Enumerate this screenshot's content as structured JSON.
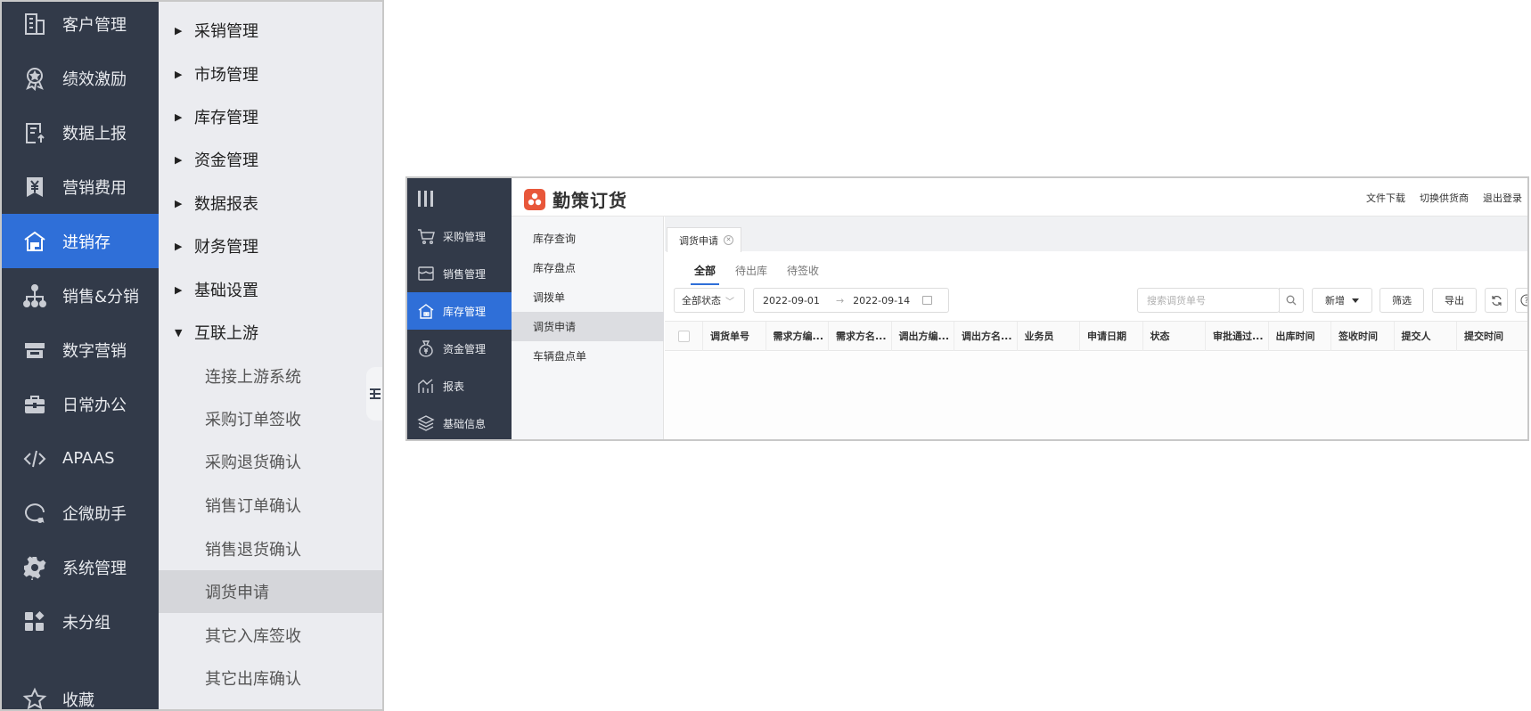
{
  "left_panel": {
    "nav_items": [
      {
        "label": "客户管理",
        "icon": "building-icon",
        "active": false
      },
      {
        "label": "绩效激励",
        "icon": "medal-icon",
        "active": false
      },
      {
        "label": "数据上报",
        "icon": "report-upload-icon",
        "active": false
      },
      {
        "label": "营销费用",
        "icon": "yen-bookmark-icon",
        "active": false
      },
      {
        "label": "进销存",
        "icon": "warehouse-icon",
        "active": true
      },
      {
        "label": "销售&分销",
        "icon": "org-tree-icon",
        "active": false
      },
      {
        "label": "数字营销",
        "icon": "store-icon",
        "active": false
      },
      {
        "label": "日常办公",
        "icon": "briefcase-icon",
        "active": false
      },
      {
        "label": "APAAS",
        "icon": "code-icon",
        "active": false
      },
      {
        "label": "企微助手",
        "icon": "chat-user-icon",
        "active": false
      },
      {
        "label": "系统管理",
        "icon": "gear-icon",
        "active": false
      },
      {
        "label": "未分组",
        "icon": "grid-apps-icon",
        "active": false
      },
      {
        "label": "收藏",
        "icon": "star-icon",
        "active": false
      }
    ],
    "submenu": [
      {
        "label": "采销管理"
      },
      {
        "label": "市场管理"
      },
      {
        "label": "库存管理"
      },
      {
        "label": "资金管理"
      },
      {
        "label": "数据报表"
      },
      {
        "label": "财务管理"
      },
      {
        "label": "基础设置"
      },
      {
        "label": "互联上游"
      }
    ],
    "submenu_children": [
      {
        "label": "连接上游系统",
        "active": false
      },
      {
        "label": "采购订单签收",
        "active": false
      },
      {
        "label": "采购退货确认",
        "active": false
      },
      {
        "label": "销售订单确认",
        "active": false
      },
      {
        "label": "销售退货确认",
        "active": false
      },
      {
        "label": "调货申请",
        "active": true
      },
      {
        "label": "其它入库签收",
        "active": false
      },
      {
        "label": "其它出库确认",
        "active": false
      }
    ]
  },
  "app": {
    "brand": {
      "name": "勤策订货",
      "color": "#e8573a"
    },
    "header_links": [
      "文件下载",
      "切换供货商",
      "退出登录"
    ],
    "nav_items": [
      {
        "label": "采购管理",
        "icon": "cart-icon",
        "active": false
      },
      {
        "label": "销售管理",
        "icon": "storefront-icon",
        "active": false
      },
      {
        "label": "库存管理",
        "icon": "warehouse-icon",
        "active": true
      },
      {
        "label": "资金管理",
        "icon": "money-bag-icon",
        "active": false
      },
      {
        "label": "报表",
        "icon": "chart-icon",
        "active": false
      },
      {
        "label": "基础信息",
        "icon": "layers-icon",
        "active": false
      }
    ],
    "submenu": [
      {
        "label": "库存查询",
        "active": false
      },
      {
        "label": "库存盘点",
        "active": false
      },
      {
        "label": "调拨单",
        "active": false
      },
      {
        "label": "调货申请",
        "active": true
      },
      {
        "label": "车辆盘点单",
        "active": false
      }
    ],
    "page_tab": {
      "label": "调货申请"
    },
    "status_tabs": [
      {
        "label": "全部",
        "active": true
      },
      {
        "label": "待出库",
        "active": false
      },
      {
        "label": "待签收",
        "active": false
      }
    ],
    "toolbar": {
      "status_select": "全部状态",
      "date_start": "2022-09-01",
      "date_end": "2022-09-14",
      "search_placeholder": "搜索调货单号",
      "add_label": "新增",
      "filter_label": "筛选",
      "export_label": "导出"
    },
    "table": {
      "columns": [
        "调货单号",
        "需求方编...",
        "需求方名...",
        "调出方编...",
        "调出方名...",
        "业务员",
        "申请日期",
        "状态",
        "审批通过...",
        "出库时间",
        "签收时间",
        "提交人",
        "提交时间"
      ],
      "rows": []
    },
    "accent_color": "#2f6fd8"
  }
}
